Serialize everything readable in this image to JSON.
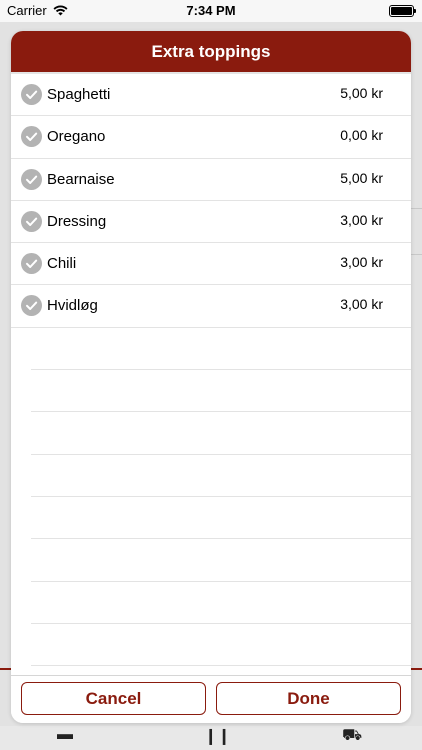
{
  "status_bar": {
    "carrier": "Carrier",
    "time": "7:34 PM"
  },
  "modal": {
    "title": "Extra toppings",
    "items": [
      {
        "name": "Spaghetti",
        "price": "5,00 kr",
        "checked": true
      },
      {
        "name": "Oregano",
        "price": "0,00 kr",
        "checked": true
      },
      {
        "name": "Bearnaise",
        "price": "5,00 kr",
        "checked": true
      },
      {
        "name": "Dressing",
        "price": "3,00 kr",
        "checked": true
      },
      {
        "name": "Chili",
        "price": "3,00 kr",
        "checked": true
      },
      {
        "name": "Hvidløg",
        "price": "3,00 kr",
        "checked": true
      }
    ],
    "cancel_label": "Cancel",
    "done_label": "Done"
  },
  "colors": {
    "brand": "#8a1b0e",
    "check": "#b3b3b3"
  }
}
